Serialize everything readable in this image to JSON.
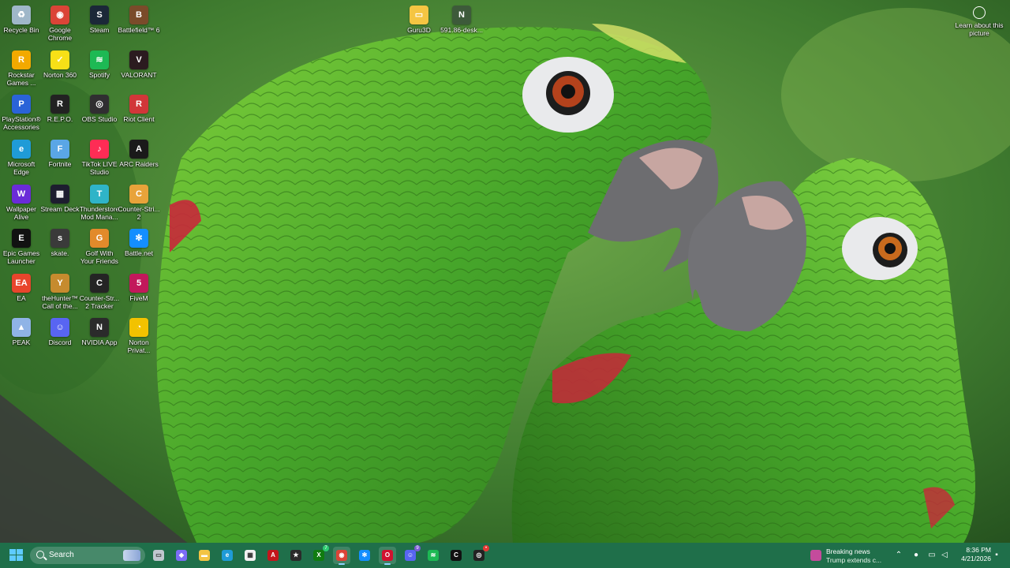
{
  "desktop": {
    "learn_about": "Learn about this picture",
    "icons": [
      {
        "label": "Recycle Bin",
        "color": "#9fb7c9",
        "glyph": "♻"
      },
      {
        "label": "Google Chrome",
        "color": "#db4437",
        "glyph": "◉"
      },
      {
        "label": "Steam",
        "color": "#1b2838",
        "glyph": "S"
      },
      {
        "label": "Battlefield™ 6",
        "color": "#7a4b2a",
        "glyph": "B"
      },
      {
        "label": "Rockstar Games ...",
        "color": "#f2a900",
        "glyph": "R"
      },
      {
        "label": "Norton 360",
        "color": "#f7e017",
        "glyph": "✓"
      },
      {
        "label": "Spotify",
        "color": "#1db954",
        "glyph": "≋"
      },
      {
        "label": "VALORANT",
        "color": "#2b1b1f",
        "glyph": "V"
      },
      {
        "label": "PlayStation® Accessories",
        "color": "#2a63d8",
        "glyph": "P"
      },
      {
        "label": "R.E.P.O.",
        "color": "#222222",
        "glyph": "R"
      },
      {
        "label": "OBS Studio",
        "color": "#302e31",
        "glyph": "◎"
      },
      {
        "label": "Riot Client",
        "color": "#d13639",
        "glyph": "R"
      },
      {
        "label": "Microsoft Edge",
        "color": "#1f9bd7",
        "glyph": "e"
      },
      {
        "label": "Fortnite",
        "color": "#5aa6e6",
        "glyph": "F"
      },
      {
        "label": "TikTok LIVE Studio",
        "color": "#fe2c55",
        "glyph": "♪"
      },
      {
        "label": "ARC Raiders",
        "color": "#1a1a1a",
        "glyph": "A"
      },
      {
        "label": "Wallpaper Alive",
        "color": "#6a2bd8",
        "glyph": "W"
      },
      {
        "label": "Stream Deck",
        "color": "#1d1d2f",
        "glyph": "▦"
      },
      {
        "label": "Thunderstore Mod Mana...",
        "color": "#2fb4c8",
        "glyph": "T"
      },
      {
        "label": "Counter-Stri... 2",
        "color": "#e8a33a",
        "glyph": "C"
      },
      {
        "label": "Epic Games Launcher",
        "color": "#111111",
        "glyph": "E"
      },
      {
        "label": "skate.",
        "color": "#3a3a3a",
        "glyph": "s"
      },
      {
        "label": "Golf With Your Friends",
        "color": "#e28a2b",
        "glyph": "G"
      },
      {
        "label": "Battle.net",
        "color": "#148eff",
        "glyph": "✻"
      },
      {
        "label": "EA",
        "color": "#e8452c",
        "glyph": "EA"
      },
      {
        "label": "theHunter™ Call of the...",
        "color": "#c68b2e",
        "glyph": "Y"
      },
      {
        "label": "Counter-Str... 2 Tracker",
        "color": "#242424",
        "glyph": "C"
      },
      {
        "label": "FiveM",
        "color": "#c2185b",
        "glyph": "5"
      },
      {
        "label": "PEAK",
        "color": "#8fb3e6",
        "glyph": "▲"
      },
      {
        "label": "Discord",
        "color": "#5865f2",
        "glyph": "☺"
      },
      {
        "label": "NVIDIA App",
        "color": "#2b2b2b",
        "glyph": "N"
      },
      {
        "label": "Norton Privat...",
        "color": "#f2c200",
        "glyph": "◔"
      },
      {
        "label": "Guru3D",
        "color": "#f5c542",
        "glyph": "▭"
      },
      {
        "label": "591.86-desk...",
        "color": "#3d5a3a",
        "glyph": "N"
      }
    ]
  },
  "taskbar": {
    "search_placeholder": "Search",
    "apps": [
      {
        "name": "task-view",
        "color": "#bfc7cf",
        "glyph": "▭",
        "active": false
      },
      {
        "name": "copilot",
        "color": "#7b6cf6",
        "glyph": "◆",
        "active": false
      },
      {
        "name": "file-explorer",
        "color": "#f3c443",
        "glyph": "▬",
        "active": false
      },
      {
        "name": "edge",
        "color": "#1f9bd7",
        "glyph": "e",
        "active": false
      },
      {
        "name": "microsoft-store",
        "color": "#f1f1f1",
        "glyph": "▦",
        "active": false
      },
      {
        "name": "acrobat",
        "color": "#c4161c",
        "glyph": "A",
        "active": false
      },
      {
        "name": "star-app",
        "color": "#2a2a2a",
        "glyph": "★",
        "active": false
      },
      {
        "name": "xbox",
        "color": "#107c10",
        "glyph": "X",
        "active": false,
        "badge": "7"
      },
      {
        "name": "chrome",
        "color": "#db4437",
        "glyph": "◉",
        "active": true
      },
      {
        "name": "battle-net",
        "color": "#148eff",
        "glyph": "✻",
        "active": false
      },
      {
        "name": "opera-gx",
        "color": "#d1122f",
        "glyph": "O",
        "active": true
      },
      {
        "name": "discord",
        "color": "#5865f2",
        "glyph": "☺",
        "active": false,
        "badge": "9"
      },
      {
        "name": "spotify",
        "color": "#1db954",
        "glyph": "≋",
        "active": false
      },
      {
        "name": "call-of-duty",
        "color": "#111111",
        "glyph": "C",
        "active": false
      },
      {
        "name": "rockstar-tracker",
        "color": "#222222",
        "glyph": "◎",
        "active": false,
        "badge": "•"
      }
    ],
    "news_title": "Breaking news",
    "news_subtitle": "Trump extends c...",
    "time": "8:36 PM",
    "date": "4/21/2026"
  }
}
